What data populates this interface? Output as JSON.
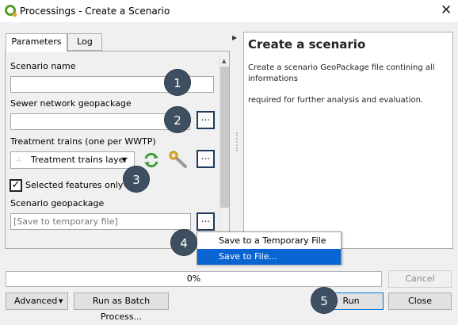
{
  "window": {
    "title": "Processings - Create a Scenario",
    "close_glyph": "✕",
    "app_icon": "qgis-icon"
  },
  "tabs": [
    {
      "label": "Parameters",
      "active": true
    },
    {
      "label": "Log",
      "active": false
    }
  ],
  "params": {
    "scenario_name_label": "Scenario name",
    "scenario_name_value": "",
    "sewer_label": "Sewer network geopackage",
    "sewer_value": "",
    "sewer_button": "...",
    "treatment_label": "Treatment trains (one per WWTP)",
    "treatment_combo": "Treatment trains layer",
    "treatment_button": "...",
    "selected_only_label": "Selected features only",
    "selected_only_checked": true,
    "check_glyph": "✓",
    "geopackage_label": "Scenario geopackage",
    "geopackage_placeholder": "[Save to temporary file]",
    "geopackage_button": "..."
  },
  "badges": [
    "1",
    "2",
    "3",
    "4",
    "5"
  ],
  "menu": {
    "items": [
      {
        "label": "Save to a Temporary File",
        "selected": false
      },
      {
        "label": "Save to File...",
        "selected": true
      }
    ]
  },
  "help": {
    "title": "Create a scenario",
    "line1": "Create a scenario GeoPackage file contining all informations",
    "line2": "required for further analysis and evaluation."
  },
  "progress": {
    "text": "0%",
    "value": 0
  },
  "buttons": {
    "cancel": "Cancel",
    "advanced": "Advanced",
    "batch": "Run as Batch Process...",
    "run": "Run",
    "close": "Close"
  },
  "colors": {
    "badge": "#3f4f62",
    "menu_highlight": "#0a64d2",
    "qgis_green": "#5a9b2e"
  }
}
